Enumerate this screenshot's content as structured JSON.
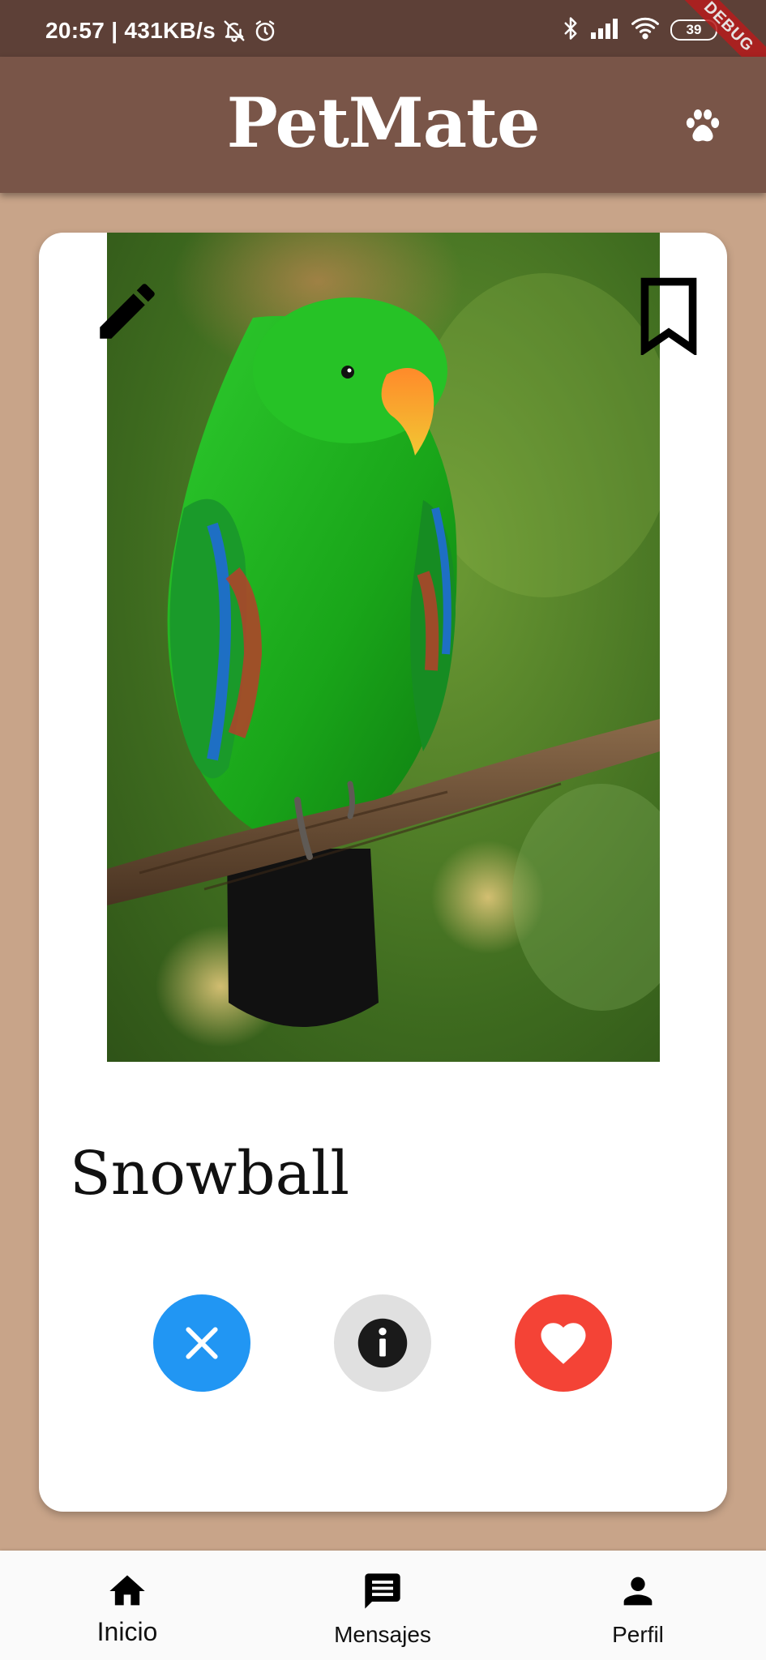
{
  "status_bar": {
    "time_speed": "20:57 | 431KB/s",
    "battery": "39",
    "debug_label": "DEBUG"
  },
  "app_bar": {
    "title": "PetMate",
    "icon": "paw-icon"
  },
  "card": {
    "pet_name": "Snowball",
    "photo_subject": "eclectus-parrot-photo",
    "edit_icon": "pencil-icon",
    "bookmark_icon": "bookmark-icon",
    "actions": {
      "dislike_icon": "close-icon",
      "info_icon": "info-icon",
      "like_icon": "heart-icon"
    }
  },
  "colors": {
    "status_bar": "#5d4037",
    "app_bar": "#795548",
    "background": "#c8a489",
    "dislike": "#2196f3",
    "info": "#e0e0e0",
    "like": "#f44336"
  },
  "bottom_nav": {
    "items": [
      {
        "label": "Inicio",
        "icon": "home-icon"
      },
      {
        "label": "Mensajes",
        "icon": "chat-icon"
      },
      {
        "label": "Perfil",
        "icon": "person-icon"
      }
    ]
  }
}
